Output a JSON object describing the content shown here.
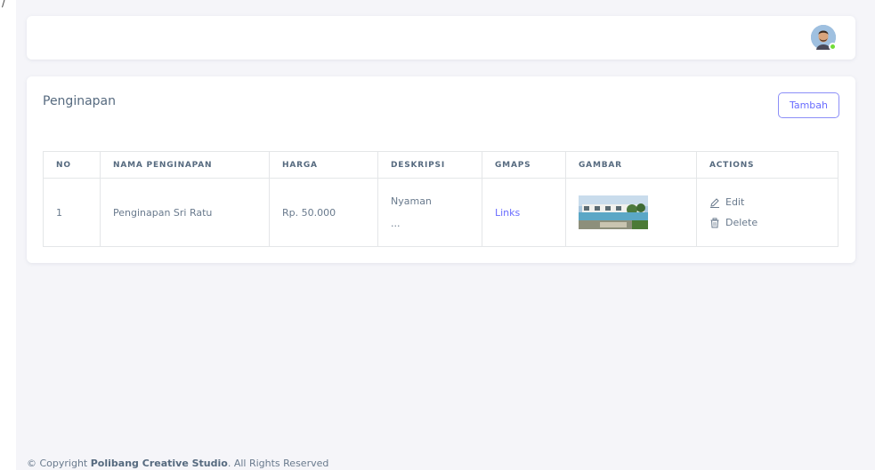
{
  "navbar": {
    "avatar_name": "user-avatar"
  },
  "card": {
    "title": "Penginapan",
    "add_button": "Tambah"
  },
  "table": {
    "headers": [
      "NO",
      "NAMA PENGINAPAN",
      "HARGA",
      "DESKRIPSI",
      "GMAPS",
      "GAMBAR",
      "ACTIONS"
    ],
    "rows": [
      {
        "no": "1",
        "nama": "Penginapan Sri Ratu",
        "harga": "Rp. 50.000",
        "deskripsi_line1": "Nyaman",
        "deskripsi_line2": "...",
        "gmaps": "Links",
        "actions": {
          "edit": "Edit",
          "delete": "Delete"
        }
      }
    ]
  },
  "footer": {
    "prefix": "© Copyright ",
    "company": "Polibang Creative Studio",
    "suffix": ". All Rights Reserved"
  },
  "colors": {
    "primary": "#696cff",
    "online": "#71dd37",
    "background": "#f5f5f9"
  }
}
